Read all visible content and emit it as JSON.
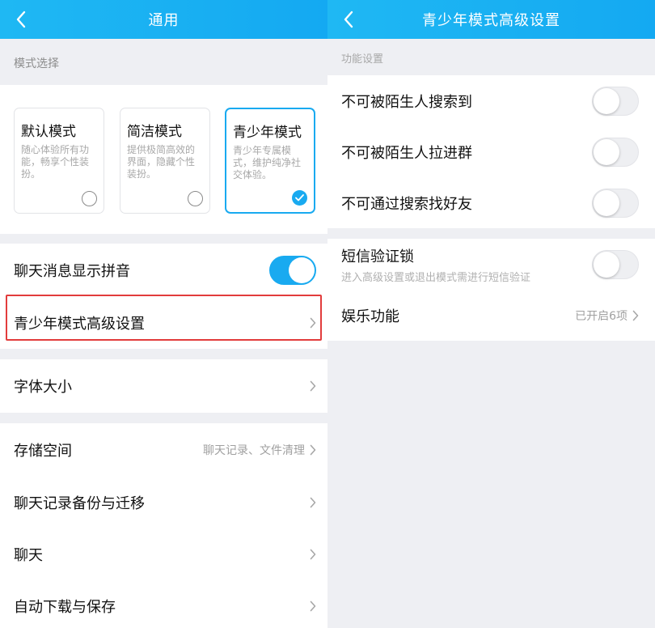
{
  "left": {
    "title": "通用",
    "section_mode": "模式选择",
    "modes": [
      {
        "name": "默认模式",
        "desc": "随心体验所有功能，畅享个性装扮。",
        "selected": false
      },
      {
        "name": "简洁模式",
        "desc": "提供极简高效的界面，隐藏个性装扮。",
        "selected": false
      },
      {
        "name": "青少年模式",
        "desc": "青少年专属模式，维护纯净社交体验。",
        "selected": true
      }
    ],
    "rows": {
      "pinyin": {
        "label": "聊天消息显示拼音",
        "toggle_on": true
      },
      "teen_settings": {
        "label": "青少年模式高级设置"
      },
      "font_size": {
        "label": "字体大小"
      },
      "storage": {
        "label": "存储空间",
        "value": "聊天记录、文件清理"
      },
      "backup": {
        "label": "聊天记录备份与迁移"
      },
      "chat": {
        "label": "聊天"
      },
      "auto_download": {
        "label": "自动下载与保存"
      }
    }
  },
  "right": {
    "title": "青少年模式高级设置",
    "section_func": "功能设置",
    "rows": {
      "no_search": {
        "label": "不可被陌生人搜索到",
        "toggle_on": false
      },
      "no_group": {
        "label": "不可被陌生人拉进群",
        "toggle_on": false
      },
      "no_find": {
        "label": "不可通过搜索找好友",
        "toggle_on": false
      },
      "sms_lock": {
        "label": "短信验证锁",
        "sub": "进入高级设置或退出模式需进行短信验证",
        "toggle_on": false
      },
      "entertainment": {
        "label": "娱乐功能",
        "value": "已开启6项"
      }
    }
  },
  "colors": {
    "accent": "#19aaf0",
    "highlight": "#e23c3c"
  }
}
